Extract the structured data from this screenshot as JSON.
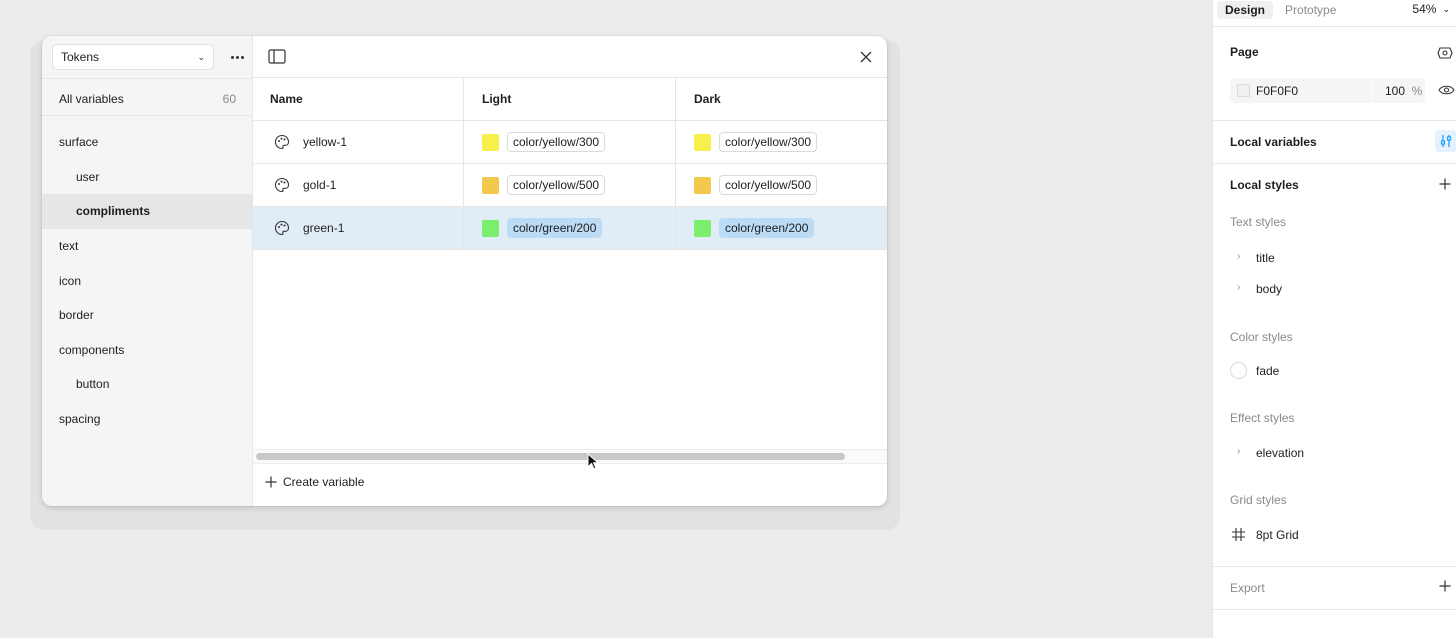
{
  "modal": {
    "collection_select": "Tokens",
    "all_variables": {
      "label": "All variables",
      "count": "60"
    },
    "groups": [
      {
        "label": "surface",
        "sub": false,
        "active": false
      },
      {
        "label": "user",
        "sub": true,
        "active": false
      },
      {
        "label": "compliments",
        "sub": true,
        "active": true
      },
      {
        "label": "text",
        "sub": false,
        "active": false
      },
      {
        "label": "icon",
        "sub": false,
        "active": false
      },
      {
        "label": "border",
        "sub": false,
        "active": false
      },
      {
        "label": "components",
        "sub": false,
        "active": false
      },
      {
        "label": "button",
        "sub": true,
        "active": false
      },
      {
        "label": "spacing",
        "sub": false,
        "active": false
      }
    ],
    "table": {
      "headers": [
        "Name",
        "Light",
        "Dark"
      ],
      "rows": [
        {
          "name": "yellow-1",
          "light": "color/yellow/300",
          "dark": "color/yellow/300",
          "light_color": "#f7f04a",
          "dark_color": "#f7f04a",
          "selected": false
        },
        {
          "name": "gold-1",
          "light": "color/yellow/500",
          "dark": "color/yellow/500",
          "light_color": "#f2c94c",
          "dark_color": "#f2c94c",
          "selected": false
        },
        {
          "name": "green-1",
          "light": "color/green/200",
          "dark": "color/green/200",
          "light_color": "#7bef6d",
          "dark_color": "#7bef6d",
          "selected": true
        }
      ]
    },
    "create_variable": "Create variable"
  },
  "panel": {
    "tabs": [
      "Design",
      "Prototype"
    ],
    "zoom": "54%",
    "page": {
      "title": "Page",
      "hex": "F0F0F0",
      "opacity": "100",
      "unit": "%"
    },
    "local_variables": "Local variables",
    "local_styles": "Local styles",
    "text_styles": {
      "title": "Text styles",
      "items": [
        "title",
        "body"
      ]
    },
    "color_styles": {
      "title": "Color styles",
      "items": [
        "fade"
      ]
    },
    "effect_styles": {
      "title": "Effect styles",
      "items": [
        "elevation"
      ]
    },
    "grid_styles": {
      "title": "Grid styles",
      "items": [
        "8pt Grid"
      ]
    },
    "export": "Export"
  },
  "colors": {
    "accent": "#0d99ff",
    "selected_row": "#e0edf7",
    "selected_token": "#bcdcf6"
  }
}
